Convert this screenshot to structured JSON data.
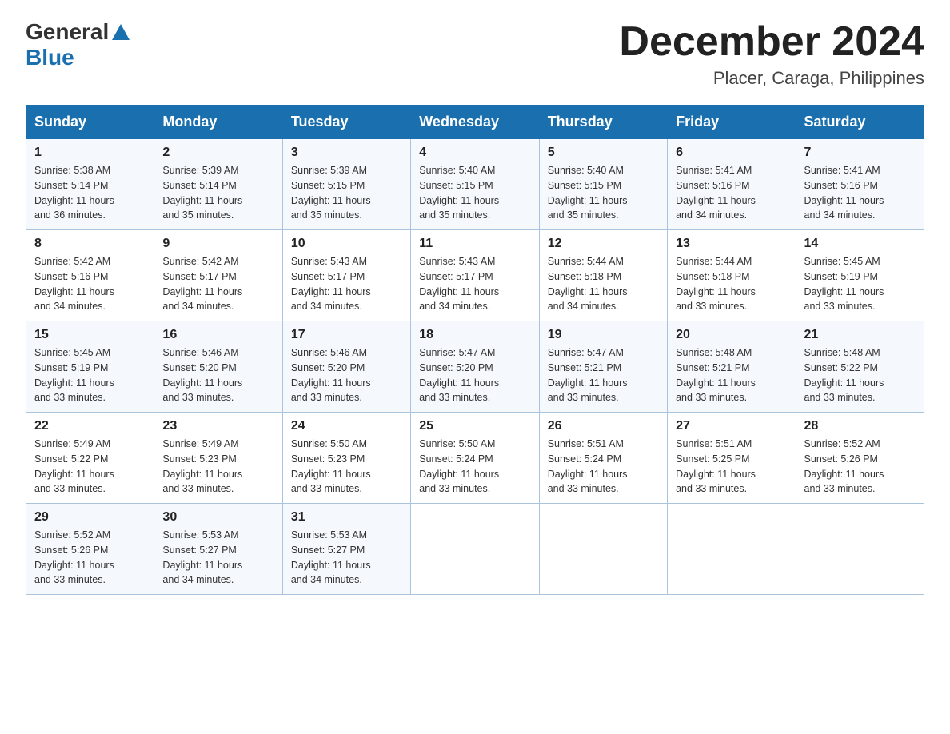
{
  "header": {
    "logo_general": "General",
    "logo_blue": "Blue",
    "title": "December 2024",
    "subtitle": "Placer, Caraga, Philippines"
  },
  "days_of_week": [
    "Sunday",
    "Monday",
    "Tuesday",
    "Wednesday",
    "Thursday",
    "Friday",
    "Saturday"
  ],
  "weeks": [
    [
      {
        "day": "1",
        "sunrise": "5:38 AM",
        "sunset": "5:14 PM",
        "daylight": "11 hours and 36 minutes."
      },
      {
        "day": "2",
        "sunrise": "5:39 AM",
        "sunset": "5:14 PM",
        "daylight": "11 hours and 35 minutes."
      },
      {
        "day": "3",
        "sunrise": "5:39 AM",
        "sunset": "5:15 PM",
        "daylight": "11 hours and 35 minutes."
      },
      {
        "day": "4",
        "sunrise": "5:40 AM",
        "sunset": "5:15 PM",
        "daylight": "11 hours and 35 minutes."
      },
      {
        "day": "5",
        "sunrise": "5:40 AM",
        "sunset": "5:15 PM",
        "daylight": "11 hours and 35 minutes."
      },
      {
        "day": "6",
        "sunrise": "5:41 AM",
        "sunset": "5:16 PM",
        "daylight": "11 hours and 34 minutes."
      },
      {
        "day": "7",
        "sunrise": "5:41 AM",
        "sunset": "5:16 PM",
        "daylight": "11 hours and 34 minutes."
      }
    ],
    [
      {
        "day": "8",
        "sunrise": "5:42 AM",
        "sunset": "5:16 PM",
        "daylight": "11 hours and 34 minutes."
      },
      {
        "day": "9",
        "sunrise": "5:42 AM",
        "sunset": "5:17 PM",
        "daylight": "11 hours and 34 minutes."
      },
      {
        "day": "10",
        "sunrise": "5:43 AM",
        "sunset": "5:17 PM",
        "daylight": "11 hours and 34 minutes."
      },
      {
        "day": "11",
        "sunrise": "5:43 AM",
        "sunset": "5:17 PM",
        "daylight": "11 hours and 34 minutes."
      },
      {
        "day": "12",
        "sunrise": "5:44 AM",
        "sunset": "5:18 PM",
        "daylight": "11 hours and 34 minutes."
      },
      {
        "day": "13",
        "sunrise": "5:44 AM",
        "sunset": "5:18 PM",
        "daylight": "11 hours and 33 minutes."
      },
      {
        "day": "14",
        "sunrise": "5:45 AM",
        "sunset": "5:19 PM",
        "daylight": "11 hours and 33 minutes."
      }
    ],
    [
      {
        "day": "15",
        "sunrise": "5:45 AM",
        "sunset": "5:19 PM",
        "daylight": "11 hours and 33 minutes."
      },
      {
        "day": "16",
        "sunrise": "5:46 AM",
        "sunset": "5:20 PM",
        "daylight": "11 hours and 33 minutes."
      },
      {
        "day": "17",
        "sunrise": "5:46 AM",
        "sunset": "5:20 PM",
        "daylight": "11 hours and 33 minutes."
      },
      {
        "day": "18",
        "sunrise": "5:47 AM",
        "sunset": "5:20 PM",
        "daylight": "11 hours and 33 minutes."
      },
      {
        "day": "19",
        "sunrise": "5:47 AM",
        "sunset": "5:21 PM",
        "daylight": "11 hours and 33 minutes."
      },
      {
        "day": "20",
        "sunrise": "5:48 AM",
        "sunset": "5:21 PM",
        "daylight": "11 hours and 33 minutes."
      },
      {
        "day": "21",
        "sunrise": "5:48 AM",
        "sunset": "5:22 PM",
        "daylight": "11 hours and 33 minutes."
      }
    ],
    [
      {
        "day": "22",
        "sunrise": "5:49 AM",
        "sunset": "5:22 PM",
        "daylight": "11 hours and 33 minutes."
      },
      {
        "day": "23",
        "sunrise": "5:49 AM",
        "sunset": "5:23 PM",
        "daylight": "11 hours and 33 minutes."
      },
      {
        "day": "24",
        "sunrise": "5:50 AM",
        "sunset": "5:23 PM",
        "daylight": "11 hours and 33 minutes."
      },
      {
        "day": "25",
        "sunrise": "5:50 AM",
        "sunset": "5:24 PM",
        "daylight": "11 hours and 33 minutes."
      },
      {
        "day": "26",
        "sunrise": "5:51 AM",
        "sunset": "5:24 PM",
        "daylight": "11 hours and 33 minutes."
      },
      {
        "day": "27",
        "sunrise": "5:51 AM",
        "sunset": "5:25 PM",
        "daylight": "11 hours and 33 minutes."
      },
      {
        "day": "28",
        "sunrise": "5:52 AM",
        "sunset": "5:26 PM",
        "daylight": "11 hours and 33 minutes."
      }
    ],
    [
      {
        "day": "29",
        "sunrise": "5:52 AM",
        "sunset": "5:26 PM",
        "daylight": "11 hours and 33 minutes."
      },
      {
        "day": "30",
        "sunrise": "5:53 AM",
        "sunset": "5:27 PM",
        "daylight": "11 hours and 34 minutes."
      },
      {
        "day": "31",
        "sunrise": "5:53 AM",
        "sunset": "5:27 PM",
        "daylight": "11 hours and 34 minutes."
      },
      null,
      null,
      null,
      null
    ]
  ],
  "labels": {
    "sunrise": "Sunrise:",
    "sunset": "Sunset:",
    "daylight": "Daylight:"
  }
}
